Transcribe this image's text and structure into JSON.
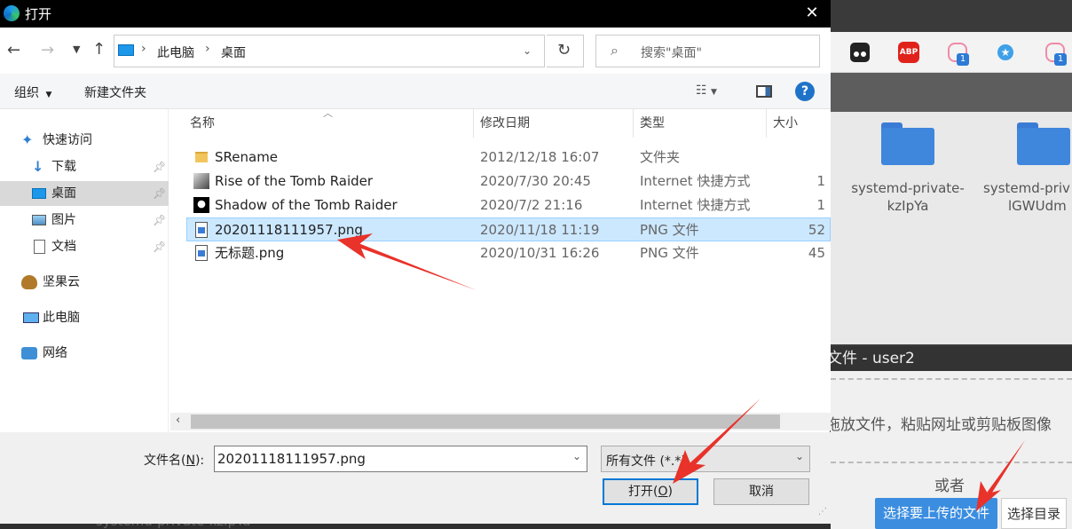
{
  "dialog": {
    "title": "打开",
    "close_glyph": "✕",
    "address": {
      "root_label": "此电脑",
      "current_label": "桌面",
      "separator": "›"
    },
    "search": {
      "placeholder": "搜索\"桌面\""
    },
    "commandbar": {
      "organize_label": "组织",
      "new_folder_label": "新建文件夹",
      "help_glyph": "?"
    },
    "nav": {
      "items": [
        {
          "label": "快速访问"
        },
        {
          "label": "下载"
        },
        {
          "label": "桌面"
        },
        {
          "label": "图片"
        },
        {
          "label": "文档"
        },
        {
          "label": "坚果云"
        },
        {
          "label": "此电脑"
        },
        {
          "label": "网络"
        }
      ]
    },
    "list": {
      "columns": {
        "name": "名称",
        "modified": "修改日期",
        "type": "类型",
        "size": "大小"
      },
      "rows": [
        {
          "name": "SRename",
          "modified": "2012/12/18 16:07",
          "type": "文件夹",
          "size": ""
        },
        {
          "name": "Rise of the Tomb Raider",
          "modified": "2020/7/30 20:45",
          "type": "Internet 快捷方式",
          "size": "1"
        },
        {
          "name": "Shadow of the Tomb Raider",
          "modified": "2020/7/2 21:16",
          "type": "Internet 快捷方式",
          "size": "1"
        },
        {
          "name": "20201118111957.png",
          "modified": "2020/11/18 11:19",
          "type": "PNG 文件",
          "size": "52"
        },
        {
          "name": "无标题.png",
          "modified": "2020/10/31 16:26",
          "type": "PNG 文件",
          "size": "45"
        }
      ],
      "selected_index": 3
    },
    "footer": {
      "filename_label": "文件名(",
      "filename_key": "N",
      "filename_label_end": "):",
      "filename_value": "20201118111957.png",
      "filetype_value": "所有文件 (*.*)",
      "open_label": "打开(",
      "open_key": "O",
      "open_label_end": ")",
      "cancel_label": "取消"
    }
  },
  "background": {
    "files": [
      {
        "line1": "systemd-private-",
        "line2": "kzIpYa"
      },
      {
        "line1": "systemd-priv",
        "line2": "lGWUdm"
      }
    ],
    "extension_badges": [
      "1",
      "1"
    ],
    "abp_label": "ABP",
    "upload_title": "文件 - user2",
    "drop_hint": "拖放文件，粘贴网址或剪贴板图像",
    "or_label": "或者",
    "choose_files_label": "选择要上传的文件",
    "choose_dir_label": "选择目录",
    "bottom_item": "systemd-private-kzIpYa"
  },
  "colors": {
    "accent": "#0078d7",
    "selection": "#cce8ff",
    "annotation_arrow": "#e8322a",
    "upload_button": "#3b8de0"
  }
}
